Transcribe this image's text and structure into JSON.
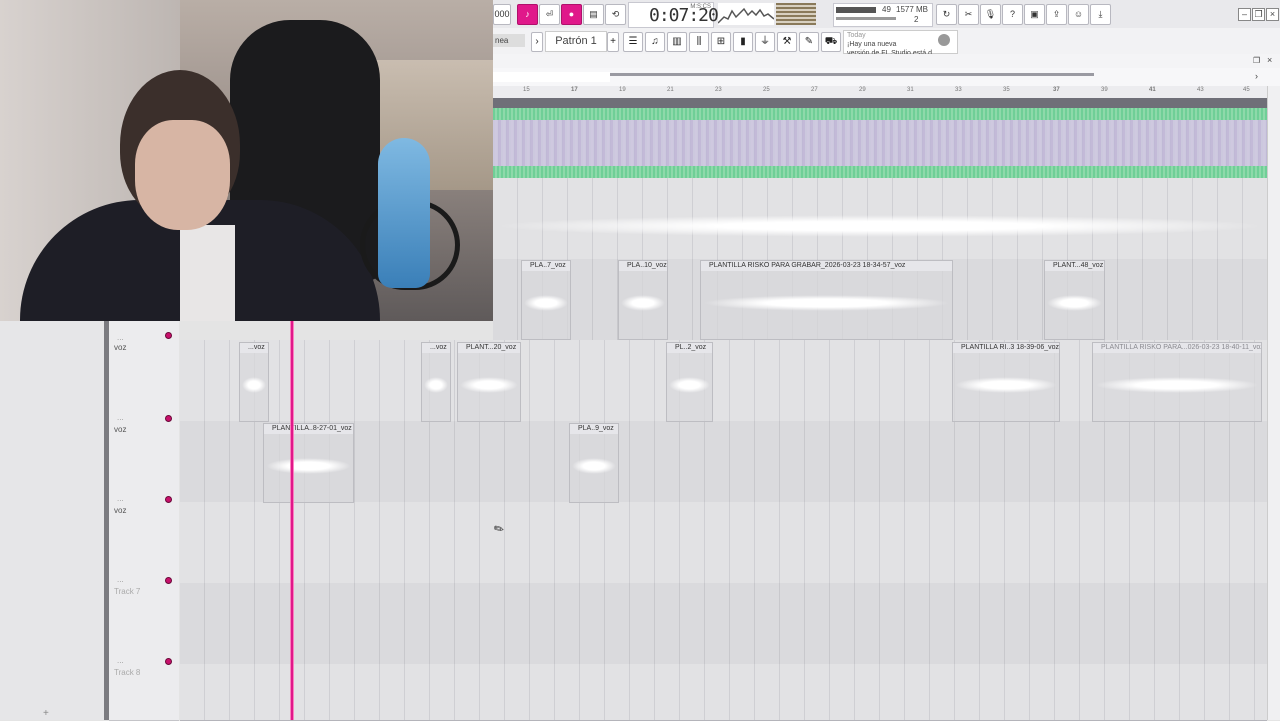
{
  "toolbar": {
    "tempo": "000",
    "time": "0:07:20",
    "time_unit": "M:S:CS",
    "cpu": "49",
    "memory": "1577 MB",
    "polyphony": "2",
    "buttons": [
      "metronome",
      "wait",
      "record-mode",
      "song-mode",
      "loop"
    ],
    "icons": [
      "undo",
      "cut",
      "mic",
      "help",
      "save",
      "export",
      "chat",
      "download"
    ]
  },
  "toolbar2": {
    "mode": "nea",
    "pattern": "Patrón 1",
    "news_date": "Today",
    "news_line1": "¡Hay una nueva",
    "news_line2": "versión de FL Studio está d…"
  },
  "ruler": {
    "ticks": [
      "15",
      "17",
      "19",
      "21",
      "23",
      "25",
      "27",
      "29",
      "31",
      "33",
      "35",
      "37",
      "39",
      "41",
      "43",
      "45"
    ]
  },
  "tracks": [
    {
      "dots": "...",
      "name": "voz"
    },
    {
      "dots": "...",
      "name": "voz"
    },
    {
      "dots": "...",
      "name": "voz"
    },
    {
      "dots": "...",
      "name": "Track 7"
    },
    {
      "dots": "...",
      "name": "Track 8"
    }
  ],
  "clips": {
    "lane3": [
      {
        "label": "PLA..7_voz"
      },
      {
        "label": "PLA..10_voz"
      },
      {
        "label": "PLANTILLA RISKO PARA GRABAR_2026-03-23 18-34-57_voz"
      },
      {
        "label": "PLANT...48_voz"
      }
    ],
    "lane4": [
      {
        "label": "...voz"
      },
      {
        "label": "...voz"
      },
      {
        "label": "PLANT...20_voz"
      },
      {
        "label": "PL..2_voz"
      },
      {
        "label": "PLANTILLA RI..3 18-39-06_voz"
      },
      {
        "label": "PLANTILLA RISKO PARA...026-03-23 18-40-11_voz"
      }
    ],
    "lane5": [
      {
        "label": "PLANTILLA..8-27-01_voz"
      },
      {
        "label": "PLA..9_voz"
      }
    ]
  },
  "colors": {
    "accent": "#e0188a",
    "master_wave": "#6fcf97",
    "master_inner": "#d6c7e6",
    "playhead": "#ff6fb7"
  }
}
